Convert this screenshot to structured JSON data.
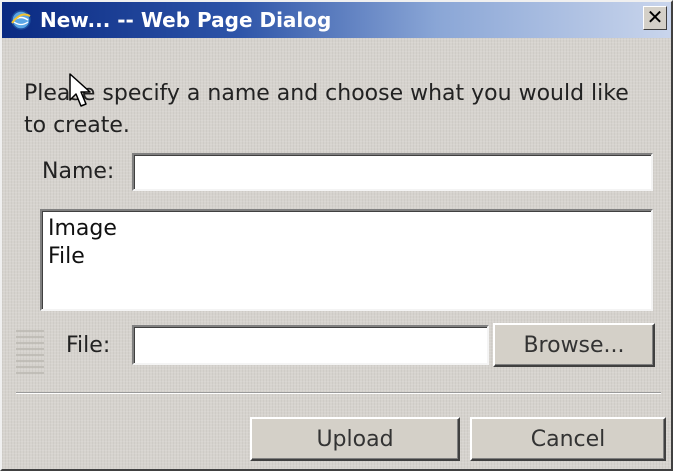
{
  "window": {
    "title": "New... -- Web Page Dialog",
    "close_label": "✕",
    "title_icon": "ie-globe-icon"
  },
  "prompt": {
    "text": "Please specify a name and choose what you would like to create."
  },
  "name_field": {
    "label": "Name:",
    "value": ""
  },
  "type_list": {
    "items": [
      "Image",
      "File"
    ]
  },
  "file_field": {
    "label": "File:",
    "value": "",
    "browse_label": "Browse..."
  },
  "actions": {
    "upload_label": "Upload",
    "cancel_label": "Cancel"
  },
  "colors": {
    "titlebar_start": "#0a2a82",
    "titlebar_end": "#c9d5ec",
    "dialog_bg": "#d6d3ce"
  }
}
